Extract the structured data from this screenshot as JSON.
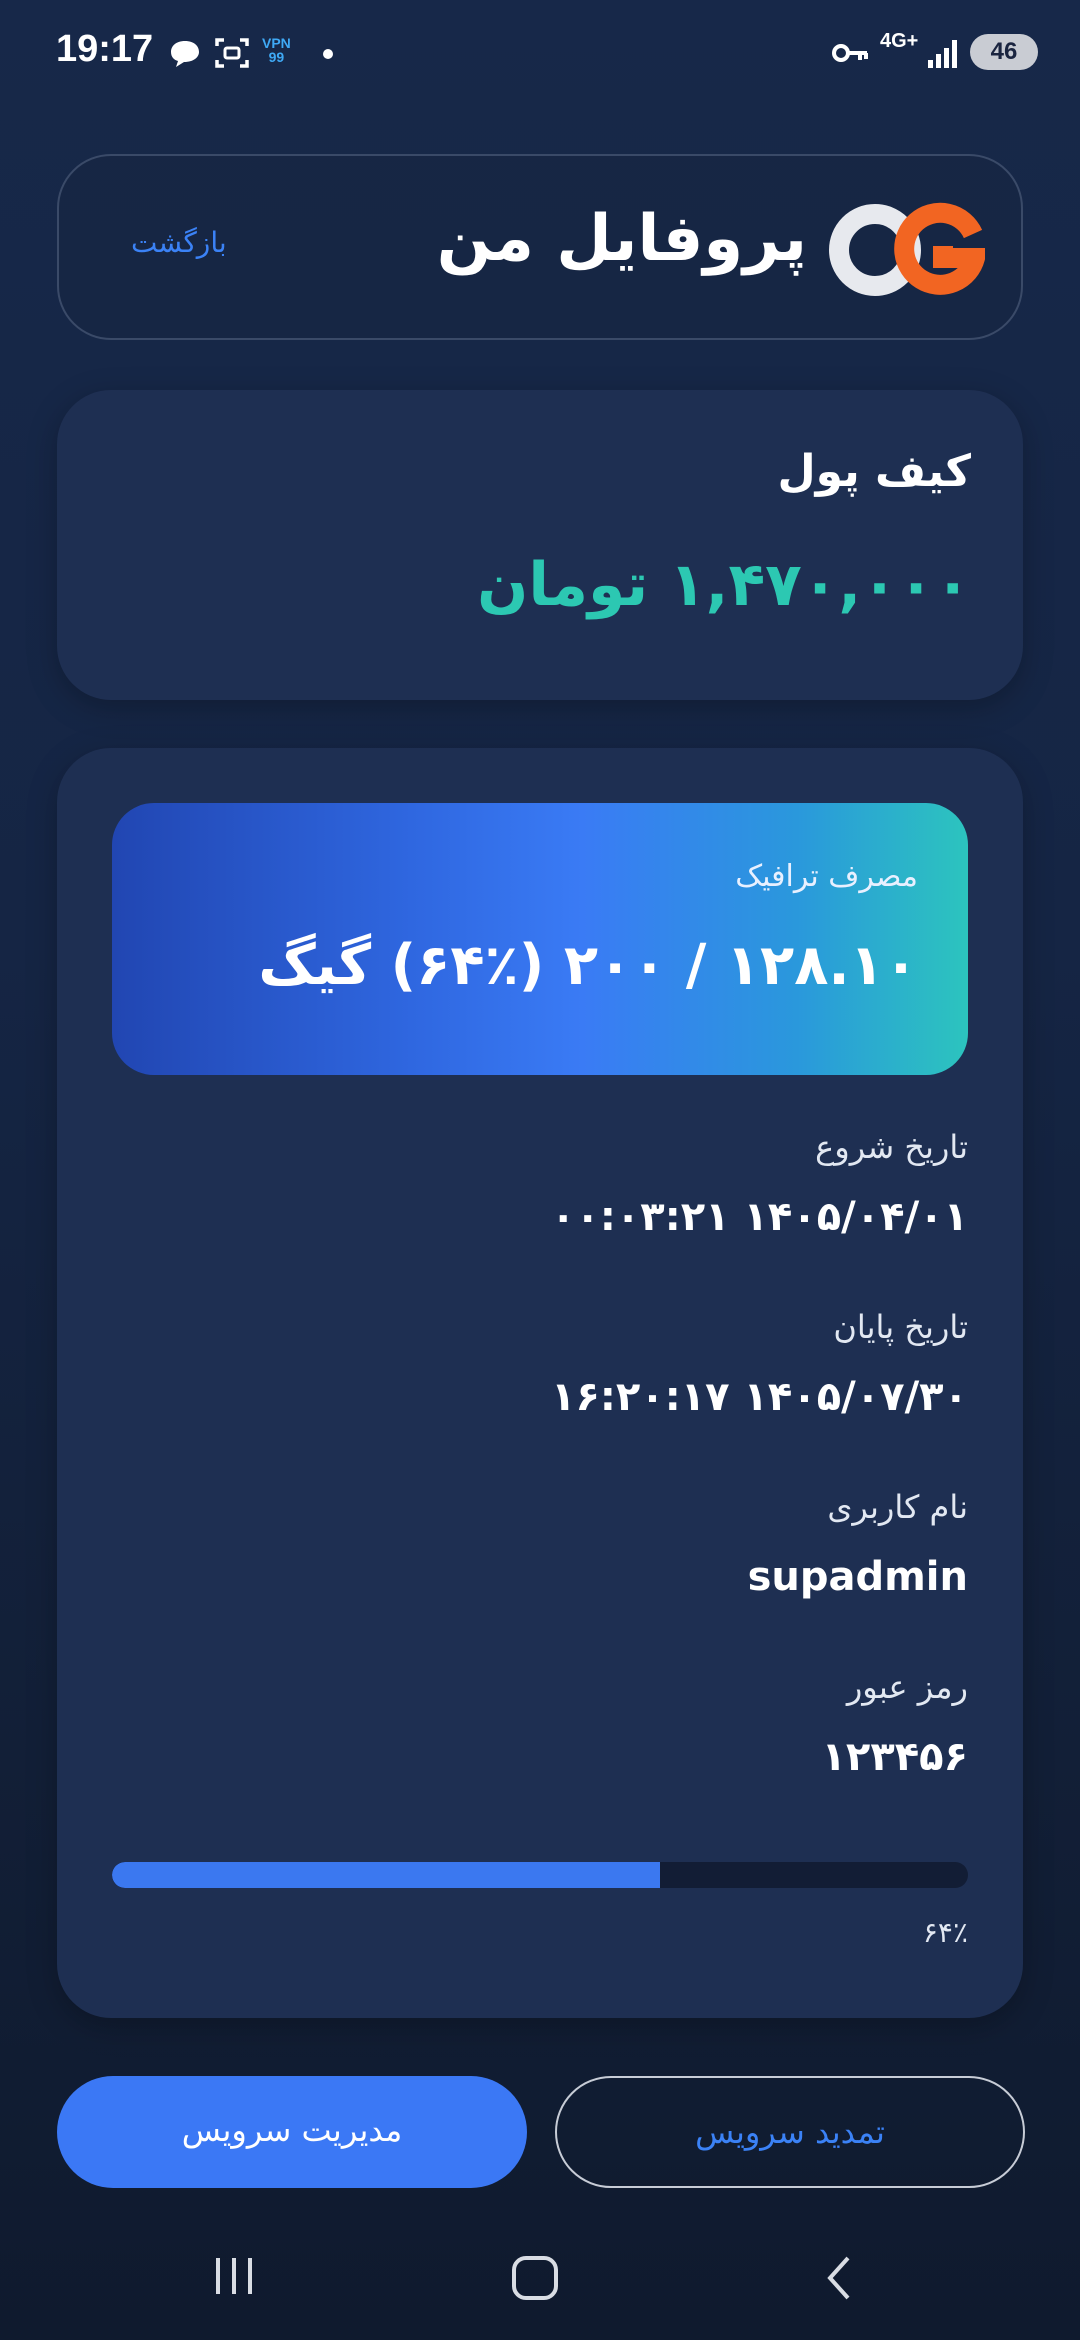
{
  "status_bar": {
    "time": "19:17",
    "vpn_line1": "VPN",
    "vpn_line2": "99",
    "network": "4G+",
    "battery": "46",
    "icons": [
      "chat-icon",
      "screenshot-icon",
      "vpn-icon",
      "dot-icon",
      "key-icon",
      "signal-icon",
      "battery-icon"
    ]
  },
  "header": {
    "title": "پروفایل من",
    "back_label": "بازگشت",
    "logo_colors": {
      "ring": "#e7e9ee",
      "accent": "#f26522"
    }
  },
  "wallet": {
    "title": "کیف پول",
    "amount": "۱,۴۷۰,۰۰۰ تومان",
    "amount_color": "#2cc8b2"
  },
  "service": {
    "traffic": {
      "label": "مصرف ترافیک",
      "value": "۱۲۸.۱۰ / ۲۰۰ (۶۴٪) گیگ"
    },
    "fields": [
      {
        "label": "تاریخ شروع",
        "value": "۱۴۰۵/۰۴/۰۱ ۰۰:۰۳:۲۱"
      },
      {
        "label": "تاریخ پایان",
        "value": "۱۴۰۵/۰۷/۳۰ ۱۶:۲۰:۱۷"
      },
      {
        "label": "نام کاربری",
        "value": "supadmin"
      },
      {
        "label": "رمز عبور",
        "value": "۱۲۳۴۵۶"
      }
    ],
    "progress": {
      "fraction": 0.64,
      "text": "۶۴٪",
      "color": "#3b78f0"
    }
  },
  "buttons": {
    "manage": "مدیریت سرویس",
    "renew": "تمدید سرویس"
  },
  "nav": {
    "icons": [
      "recent-apps-icon",
      "home-icon",
      "back-icon"
    ]
  }
}
